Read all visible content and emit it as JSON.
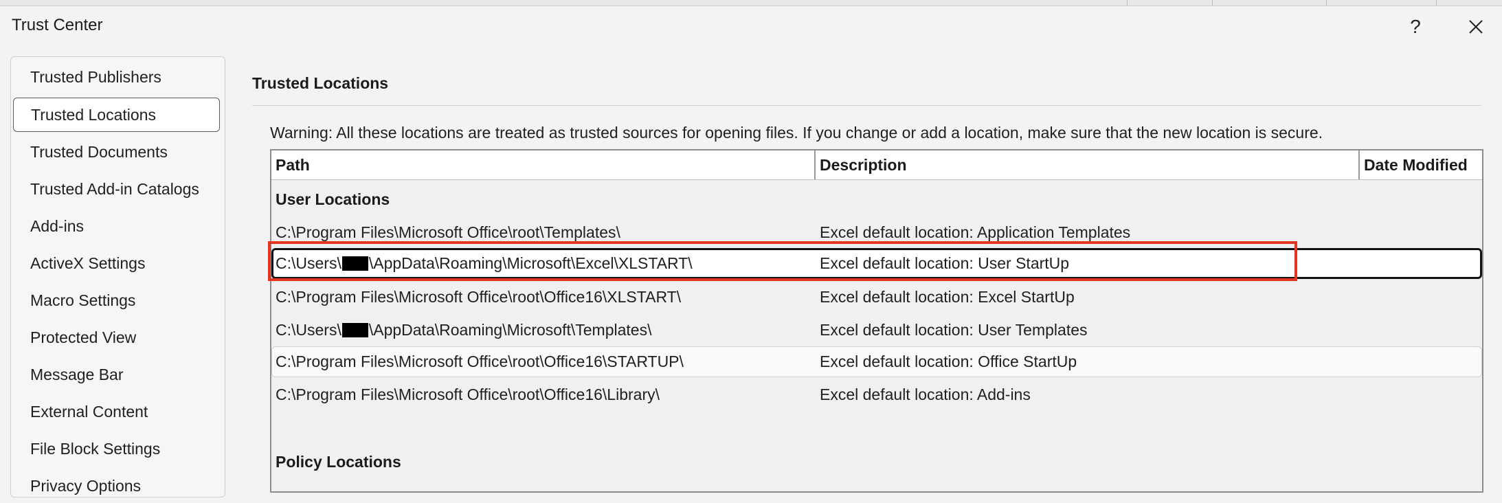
{
  "dialog": {
    "title": "Trust Center",
    "help_label": "?",
    "close_icon": "close-icon"
  },
  "sidebar": {
    "items": [
      {
        "label": "Trusted Publishers"
      },
      {
        "label": "Trusted Locations",
        "selected": true
      },
      {
        "label": "Trusted Documents"
      },
      {
        "label": "Trusted Add-in Catalogs"
      },
      {
        "label": "Add-ins"
      },
      {
        "label": "ActiveX Settings"
      },
      {
        "label": "Macro Settings"
      },
      {
        "label": "Protected View"
      },
      {
        "label": "Message Bar"
      },
      {
        "label": "External Content"
      },
      {
        "label": "File Block Settings"
      },
      {
        "label": "Privacy Options"
      }
    ]
  },
  "main": {
    "section_title": "Trusted Locations",
    "warning": "Warning: All these locations are treated as trusted sources for opening files.  If you change or add a location, make sure that the new location is secure.",
    "table": {
      "columns": [
        "Path",
        "Description",
        "Date Modified"
      ],
      "user_group_label": "User Locations",
      "policy_group_label": "Policy Locations",
      "rows": [
        {
          "path_pre": "C:\\Program Files\\Microsoft Office\\root\\Templates\\",
          "path_post": "",
          "redacted": false,
          "description": "Excel default location: Application Templates"
        },
        {
          "path_pre": "C:\\Users\\",
          "path_post": "\\AppData\\Roaming\\Microsoft\\Excel\\XLSTART\\",
          "redacted": true,
          "description": "Excel default location: User StartUp",
          "selected": true
        },
        {
          "path_pre": "C:\\Program Files\\Microsoft Office\\root\\Office16\\XLSTART\\",
          "path_post": "",
          "redacted": false,
          "description": "Excel default location: Excel StartUp"
        },
        {
          "path_pre": "C:\\Users\\",
          "path_post": "\\AppData\\Roaming\\Microsoft\\Templates\\",
          "redacted": true,
          "description": "Excel default location: User Templates"
        },
        {
          "path_pre": "C:\\Program Files\\Microsoft Office\\root\\Office16\\STARTUP\\",
          "path_post": "",
          "redacted": false,
          "description": "Excel default location: Office StartUp",
          "hover": true
        },
        {
          "path_pre": "C:\\Program Files\\Microsoft Office\\root\\Office16\\Library\\",
          "path_post": "",
          "redacted": false,
          "description": "Excel default location: Add-ins"
        }
      ]
    }
  },
  "colors": {
    "highlight_box": "#e53520",
    "selection_border": "#111111",
    "background": "#f3f3f3"
  }
}
